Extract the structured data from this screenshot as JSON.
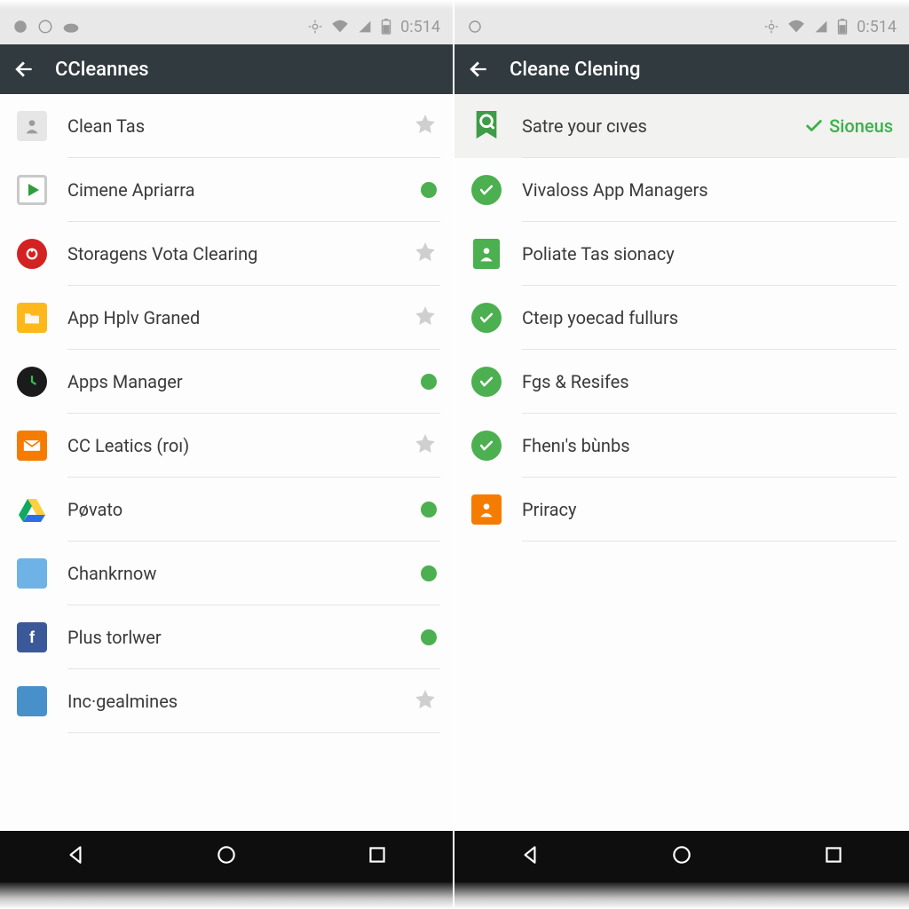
{
  "status": {
    "time": "0:514"
  },
  "left": {
    "title": "CCleannes",
    "items": [
      {
        "label": "Clean Tas",
        "icon": "person",
        "trail": "star"
      },
      {
        "label": "Cimene Apriarra",
        "icon": "play",
        "trail": "dot"
      },
      {
        "label": "Storagens Vota Clearing",
        "icon": "red",
        "trail": "star"
      },
      {
        "label": "App Hplv Graned",
        "icon": "folder",
        "trail": "star"
      },
      {
        "label": "Apps Manager",
        "icon": "black",
        "trail": "dot"
      },
      {
        "label": "CC Leatics (roı)",
        "icon": "mail",
        "trail": "star"
      },
      {
        "label": "Pøvato",
        "icon": "drive",
        "trail": "dot"
      },
      {
        "label": "Chankrnow",
        "icon": "misc1",
        "trail": "dot"
      },
      {
        "label": "Plus torlwer",
        "icon": "fb",
        "trail": "dot"
      },
      {
        "label": "Inc·gealmines",
        "icon": "misc2",
        "trail": "star"
      }
    ]
  },
  "right": {
    "title": "Cleane Clening",
    "header": {
      "label": "Satre your cıves",
      "status": "Sioneus"
    },
    "items": [
      {
        "label": "Vivaloss App Managers",
        "icon": "check"
      },
      {
        "label": "Poliate Tas sionacy",
        "icon": "person2"
      },
      {
        "label": "Cteıp yoecad fullurs",
        "icon": "check"
      },
      {
        "label": "Fgs & Resifes",
        "icon": "check"
      },
      {
        "label": "Fhenı's bùnbs",
        "icon": "check"
      },
      {
        "label": "Priracy",
        "icon": "orange"
      }
    ]
  }
}
